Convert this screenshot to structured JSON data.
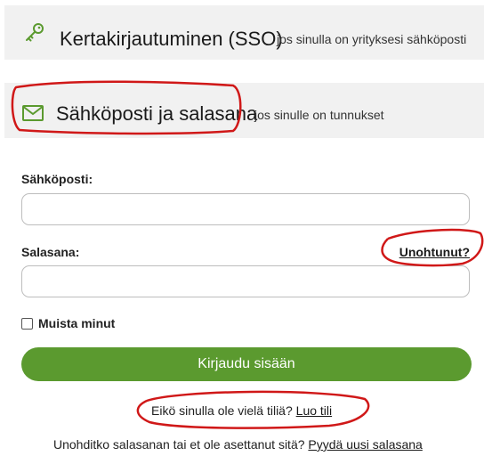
{
  "sso": {
    "title": "Kertakirjautuminen (SSO)",
    "description": "jos sinulla on yrityksesi sähköposti",
    "icon": "key-icon"
  },
  "email_login": {
    "title": "Sähköposti ja salasana",
    "description": "jos sinulle on tunnukset",
    "icon": "envelope-icon"
  },
  "form": {
    "email_label": "Sähköposti:",
    "email_value": "",
    "password_label": "Salasana:",
    "password_value": "",
    "forgot_link": "Unohtunut?",
    "remember_label": "Muista minut",
    "submit_label": "Kirjaudu sisään"
  },
  "footer": {
    "no_account_text": "Eikö sinulla ole vielä tiliä?",
    "create_account_link": "Luo tili",
    "reset_text": "Unohditko salasanan tai et ole asettanut sitä?",
    "reset_link": "Pyydä uusi salasana"
  },
  "colors": {
    "accent": "#5b9a2f",
    "panel_bg": "#f1f1f1",
    "annotation": "#d01818"
  }
}
